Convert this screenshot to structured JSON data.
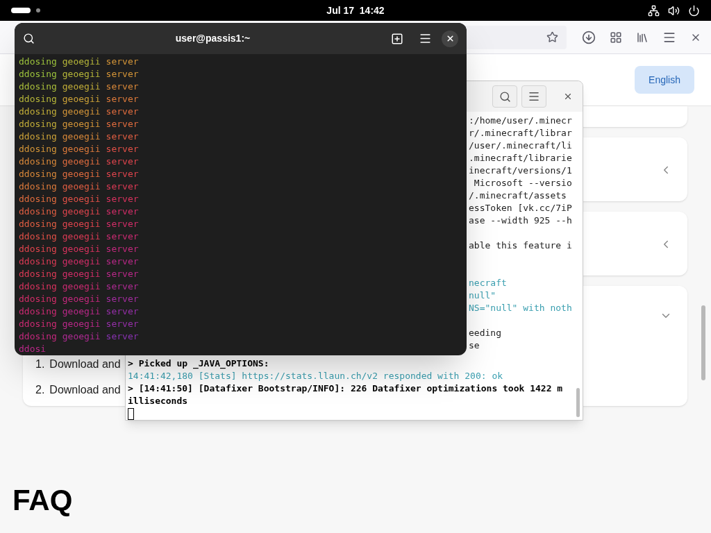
{
  "top_bar": {
    "clock": "Jul 17  14:42"
  },
  "browser": {
    "language_button": "English",
    "cards": [
      {
        "expanded": false
      },
      {
        "expanded": false
      },
      {
        "expanded": true,
        "steps": [
          {
            "number": "1.",
            "text": "Download and"
          },
          {
            "number": "2.",
            "text": "Download and"
          }
        ]
      }
    ],
    "heading": "FAQ"
  },
  "back_terminal": {
    "upper_lines": [
      {
        "kind": "plain",
        "text": ":/home/user/.minecr"
      },
      {
        "kind": "plain",
        "text": "r/.minecraft/librar"
      },
      {
        "kind": "plain",
        "text": "/user/.minecraft/li"
      },
      {
        "kind": "plain",
        "text": ".minecraft/librarie"
      },
      {
        "kind": "plain",
        "text": "inecraft/versions/1"
      },
      {
        "kind": "plain",
        "text": " Microsoft --versio"
      },
      {
        "kind": "plain",
        "text": "/.minecraft/assets"
      },
      {
        "kind": "plain",
        "text": "essToken [vk.cc/7iP"
      },
      {
        "kind": "plain",
        "text": "ase --width 925 --h"
      },
      {
        "kind": "blank"
      },
      {
        "kind": "plain",
        "text": "able this feature i"
      },
      {
        "kind": "blank"
      },
      {
        "kind": "blank"
      },
      {
        "kind": "info",
        "text": "necraft"
      },
      {
        "kind": "info",
        "text": "null\""
      },
      {
        "kind": "info",
        "text": "NS=\"null\" with noth"
      },
      {
        "kind": "blank"
      },
      {
        "kind": "plain",
        "text": "eeding"
      },
      {
        "kind": "plain",
        "text": "se"
      }
    ],
    "lower_lines": [
      {
        "kind": "bold",
        "text": "> Picked up _JAVA_OPTIONS:"
      },
      {
        "kind": "info",
        "text": "14:41:42,180 [Stats] https://stats.llaun.ch/v2 responded with 200: ok"
      },
      {
        "kind": "bold",
        "text": "> [14:41:50] [Datafixer Bootstrap/INFO]: 226 Datafixer optimizations took 1422 m"
      },
      {
        "kind": "bold",
        "text": "illiseconds"
      },
      {
        "kind": "cursor"
      }
    ]
  },
  "front_terminal": {
    "title": "user@passis1:~",
    "lines": [
      {
        "segments": [
          {
            "text": "ddosing",
            "color": "#9cc23c"
          },
          {
            "text": "geoegii",
            "color": "#b6b639"
          },
          {
            "text": "server",
            "color": "#d49538"
          }
        ]
      },
      {
        "segments": [
          {
            "text": "ddosing",
            "color": "#9cc23c"
          },
          {
            "text": "geoegii",
            "color": "#b6b639"
          },
          {
            "text": "server",
            "color": "#d49538"
          }
        ]
      },
      {
        "segments": [
          {
            "text": "ddosing",
            "color": "#a9bd3a"
          },
          {
            "text": "geoegii",
            "color": "#c2ad38"
          },
          {
            "text": "server",
            "color": "#d98839"
          }
        ]
      },
      {
        "segments": [
          {
            "text": "ddosing",
            "color": "#b6b639"
          },
          {
            "text": "geoegii",
            "color": "#cca238"
          },
          {
            "text": "server",
            "color": "#dd7a3b"
          }
        ]
      },
      {
        "segments": [
          {
            "text": "ddosing",
            "color": "#c2ad38"
          },
          {
            "text": "geoegii",
            "color": "#d49538"
          },
          {
            "text": "server",
            "color": "#e06c3e"
          }
        ]
      },
      {
        "segments": [
          {
            "text": "ddosing",
            "color": "#c2ad38"
          },
          {
            "text": "geoegii",
            "color": "#d49538"
          },
          {
            "text": "server",
            "color": "#e06c3e"
          }
        ]
      },
      {
        "segments": [
          {
            "text": "ddosing",
            "color": "#cca238"
          },
          {
            "text": "geoegii",
            "color": "#d98839"
          },
          {
            "text": "server",
            "color": "#e15e42"
          }
        ]
      },
      {
        "segments": [
          {
            "text": "ddosing",
            "color": "#d49538"
          },
          {
            "text": "geoegii",
            "color": "#dd7a3b"
          },
          {
            "text": "server",
            "color": "#e15047"
          }
        ]
      },
      {
        "segments": [
          {
            "text": "ddosing",
            "color": "#d98839"
          },
          {
            "text": "geoegii",
            "color": "#e06c3e"
          },
          {
            "text": "server",
            "color": "#df444d"
          }
        ]
      },
      {
        "segments": [
          {
            "text": "ddosing",
            "color": "#d98839"
          },
          {
            "text": "geoegii",
            "color": "#e06c3e"
          },
          {
            "text": "server",
            "color": "#df444d"
          }
        ]
      },
      {
        "segments": [
          {
            "text": "ddosing",
            "color": "#dd7a3b"
          },
          {
            "text": "geoegii",
            "color": "#e15e42"
          },
          {
            "text": "server",
            "color": "#dc3a55"
          }
        ]
      },
      {
        "segments": [
          {
            "text": "ddosing",
            "color": "#e06c3e"
          },
          {
            "text": "geoegii",
            "color": "#e15047"
          },
          {
            "text": "server",
            "color": "#d8325e"
          }
        ]
      },
      {
        "segments": [
          {
            "text": "ddosing",
            "color": "#e15e42"
          },
          {
            "text": "geoegii",
            "color": "#df444d"
          },
          {
            "text": "server",
            "color": "#d22d68"
          }
        ]
      },
      {
        "segments": [
          {
            "text": "ddosing",
            "color": "#e15e42"
          },
          {
            "text": "geoegii",
            "color": "#df444d"
          },
          {
            "text": "server",
            "color": "#d22d68"
          }
        ]
      },
      {
        "segments": [
          {
            "text": "ddosing",
            "color": "#e15047"
          },
          {
            "text": "geoegii",
            "color": "#dc3a55"
          },
          {
            "text": "server",
            "color": "#cb2a72"
          }
        ]
      },
      {
        "segments": [
          {
            "text": "ddosing",
            "color": "#df444d"
          },
          {
            "text": "geoegii",
            "color": "#d8325e"
          },
          {
            "text": "server",
            "color": "#c3287d"
          }
        ]
      },
      {
        "segments": [
          {
            "text": "ddosing",
            "color": "#dc3a55"
          },
          {
            "text": "geoegii",
            "color": "#d22d68"
          },
          {
            "text": "server",
            "color": "#b92888"
          }
        ]
      },
      {
        "segments": [
          {
            "text": "ddosing",
            "color": "#dc3a55"
          },
          {
            "text": "geoegii",
            "color": "#d22d68"
          },
          {
            "text": "server",
            "color": "#b92888"
          }
        ]
      },
      {
        "segments": [
          {
            "text": "ddosing",
            "color": "#d8325e"
          },
          {
            "text": "geoegii",
            "color": "#cb2a72"
          },
          {
            "text": "server",
            "color": "#ae2a93"
          }
        ]
      },
      {
        "segments": [
          {
            "text": "ddosing",
            "color": "#d22d68"
          },
          {
            "text": "geoegii",
            "color": "#c3287d"
          },
          {
            "text": "server",
            "color": "#a22c9e"
          }
        ]
      },
      {
        "segments": [
          {
            "text": "ddosing",
            "color": "#cb2a72"
          },
          {
            "text": "geoegii",
            "color": "#b92888"
          },
          {
            "text": "server",
            "color": "#952fa8"
          }
        ]
      },
      {
        "segments": [
          {
            "text": "ddosing",
            "color": "#cb2a72"
          },
          {
            "text": "geoegii",
            "color": "#b92888"
          },
          {
            "text": "server",
            "color": "#952fa8"
          }
        ]
      },
      {
        "segments": [
          {
            "text": "ddosing",
            "color": "#c3287d"
          },
          {
            "text": "geoegii",
            "color": "#ae2a93"
          },
          {
            "text": "server",
            "color": "#8832b1"
          }
        ]
      },
      {
        "segments": [
          {
            "text": "ddosi",
            "color": "#b92888"
          }
        ]
      }
    ]
  }
}
